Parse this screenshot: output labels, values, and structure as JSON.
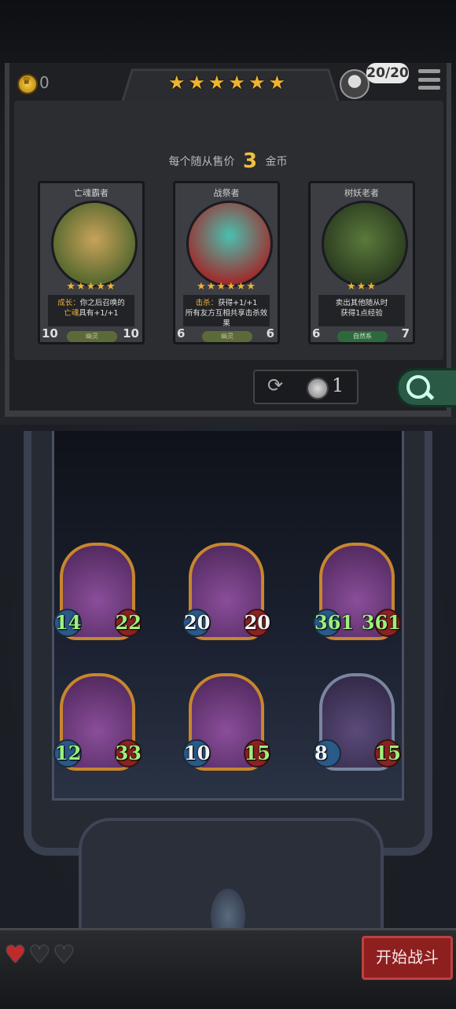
{
  "header": {
    "gold": "0",
    "tavern_stars": 6,
    "capacity": "20/20"
  },
  "shop": {
    "price_prefix": "每个随从售价",
    "price_value": "3",
    "price_suffix": "金币",
    "cards": [
      {
        "name": "亡魂霸者",
        "stars": 5,
        "desc_prefix": "成长：",
        "desc_main": "你之后召唤的",
        "desc_highlight": "亡魂",
        "desc_tail": "具有+1/+1",
        "tribe": "幽灵",
        "attack": "10",
        "health": "10",
        "portrait_colors": [
          "#c8a35a",
          "#5a6a30"
        ]
      },
      {
        "name": "战祭者",
        "stars": 6,
        "desc_prefix": "击杀：",
        "desc_main": "获得+1/+1",
        "desc_line2": "所有友方互相共享击杀效果",
        "tribe": "幽灵",
        "attack": "6",
        "health": "6",
        "portrait_colors": [
          "#4ac0b0",
          "#a02a2a"
        ]
      },
      {
        "name": "树妖老者",
        "stars": 3,
        "desc_main": "卖出其他随从时",
        "desc_line2": "获得1点经验",
        "tribe": "自然系",
        "attack": "6",
        "health": "7",
        "portrait_colors": [
          "#5a7a3a",
          "#2a3a20"
        ]
      }
    ],
    "refresh_cost": "1"
  },
  "board": {
    "minions": [
      {
        "attack": "14",
        "health": "22",
        "atk_color": "green",
        "hp_color": "green",
        "frame": "gold"
      },
      {
        "attack": "20",
        "health": "20",
        "atk_color": "white",
        "hp_color": "white",
        "frame": "gold"
      },
      {
        "attack": "361",
        "health": "361",
        "atk_color": "green",
        "hp_color": "green",
        "frame": "gold"
      },
      {
        "attack": "12",
        "health": "33",
        "atk_color": "green",
        "hp_color": "green",
        "frame": "gold"
      },
      {
        "attack": "10",
        "health": "15",
        "atk_color": "white",
        "hp_color": "green",
        "frame": "gold"
      },
      {
        "attack": "8",
        "health": "15",
        "atk_color": "white",
        "hp_color": "green",
        "frame": "gray"
      }
    ]
  },
  "footer": {
    "lives_full": 1,
    "lives_total": 3,
    "start_button": "开始战斗"
  },
  "colors": {
    "star": "#f0b32f",
    "green_stat": "#9ef07a",
    "start_button": "#8e1f1f"
  }
}
